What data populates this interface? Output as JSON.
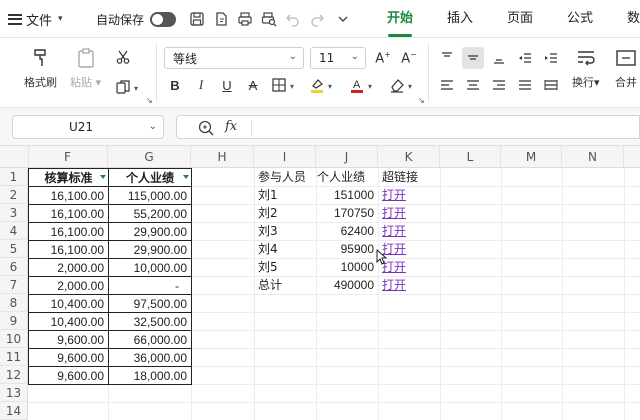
{
  "menu": {
    "file_label": "文件",
    "autosave_label": "自动保存"
  },
  "tabs": [
    {
      "label": "开始",
      "active": true
    },
    {
      "label": "插入",
      "active": false
    },
    {
      "label": "页面",
      "active": false
    },
    {
      "label": "公式",
      "active": false
    },
    {
      "label": "数据",
      "active": false
    }
  ],
  "ribbon": {
    "format_painter": "格式刷",
    "paste": "粘贴",
    "font_name": "等线",
    "font_size": "11",
    "wrap_text": "换行",
    "merge": "合并"
  },
  "formula_bar": {
    "name_box": "U21",
    "fx": "fx",
    "formula": ""
  },
  "columns": [
    "F",
    "G",
    "H",
    "I",
    "J",
    "K",
    "L",
    "M",
    "N"
  ],
  "rows": [
    "1",
    "2",
    "3",
    "4",
    "5",
    "6",
    "7",
    "8",
    "9",
    "10",
    "11",
    "12",
    "13",
    "14"
  ],
  "table1": {
    "headers": [
      "核算标准",
      "个人业绩"
    ],
    "rows": [
      [
        "16,100.00",
        "115,000.00"
      ],
      [
        "16,100.00",
        "55,200.00"
      ],
      [
        "16,100.00",
        "29,900.00"
      ],
      [
        "16,100.00",
        "29,900.00"
      ],
      [
        "2,000.00",
        "10,000.00"
      ],
      [
        "2,000.00",
        "-"
      ],
      [
        "10,400.00",
        "97,500.00"
      ],
      [
        "10,400.00",
        "32,500.00"
      ],
      [
        "9,600.00",
        "66,000.00"
      ],
      [
        "9,600.00",
        "36,000.00"
      ],
      [
        "9,600.00",
        "18,000.00"
      ]
    ]
  },
  "table2": {
    "headers": [
      "参与人员",
      "个人业绩",
      "超链接"
    ],
    "rows": [
      [
        "刘1",
        "151000",
        "打开"
      ],
      [
        "刘2",
        "170750",
        "打开"
      ],
      [
        "刘3",
        "62400",
        "打开"
      ],
      [
        "刘4",
        "95900",
        "打开"
      ],
      [
        "刘5",
        "10000",
        "打开"
      ],
      [
        "总计",
        "490000",
        "打开"
      ]
    ]
  },
  "colors": {
    "accent": "#1a8a3a",
    "link": "#7b2fbf"
  }
}
